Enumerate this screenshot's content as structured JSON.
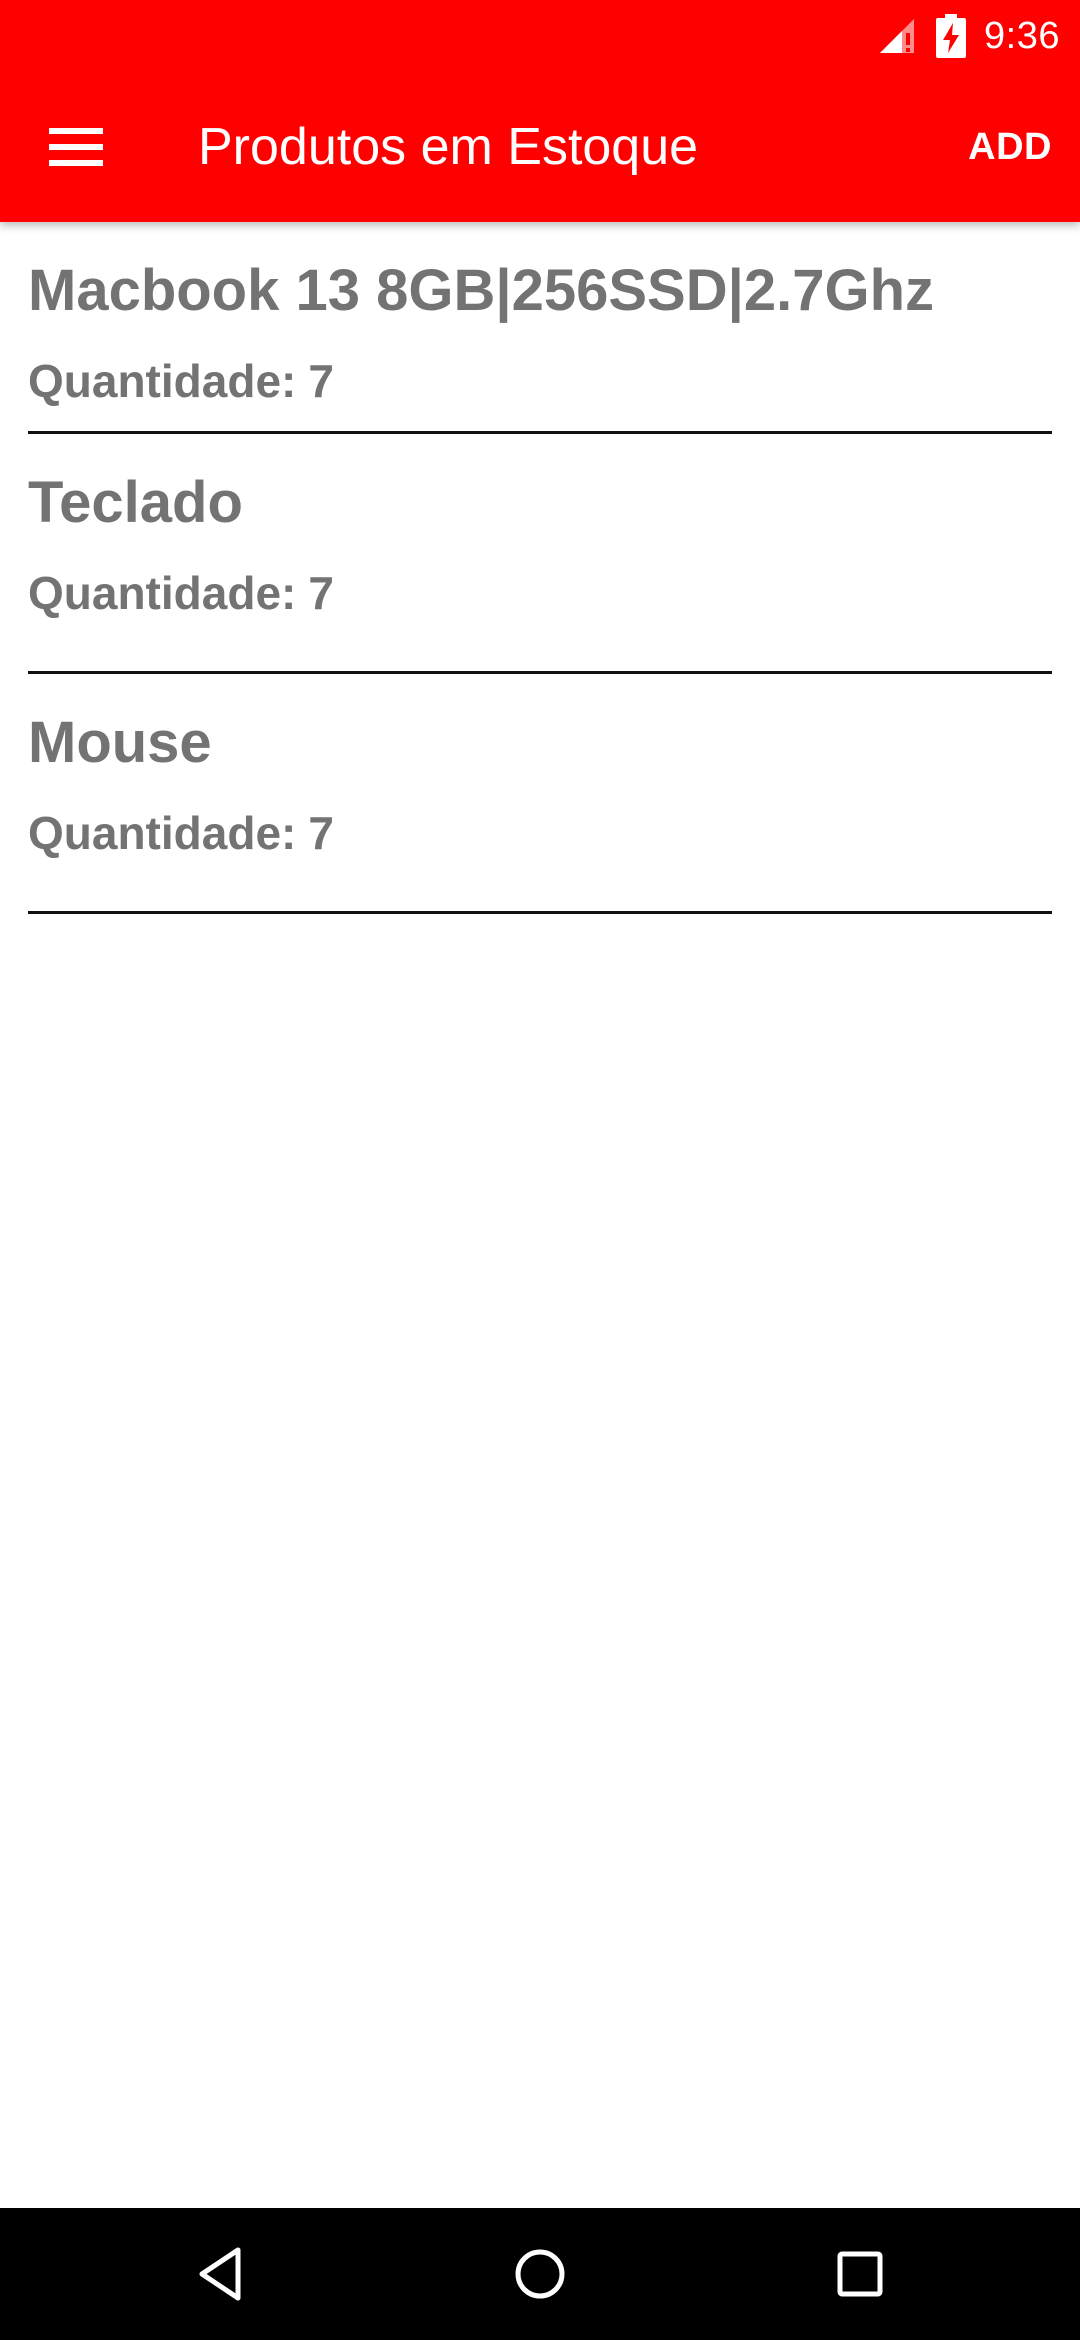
{
  "status_bar": {
    "time": "9:36",
    "icons": [
      "signal-icon",
      "battery-charging-icon"
    ]
  },
  "toolbar": {
    "menu_icon": "hamburger-menu-icon",
    "title": "Produtos em Estoque",
    "add_label": "ADD"
  },
  "products": [
    {
      "name": "Macbook 13 8GB|256SSD|2.7Ghz",
      "quantity_label": "Quantidade:",
      "quantity": "7"
    },
    {
      "name": "Teclado",
      "quantity_label": "Quantidade:",
      "quantity": "7"
    },
    {
      "name": "Mouse",
      "quantity_label": "Quantidade:",
      "quantity": "7"
    }
  ],
  "nav_bar": {
    "buttons": [
      "back-icon",
      "home-icon",
      "recents-icon"
    ]
  },
  "colors": {
    "accent": "#ff0000",
    "text_secondary": "#737373",
    "divider": "#111111",
    "nav_background": "#000000"
  }
}
